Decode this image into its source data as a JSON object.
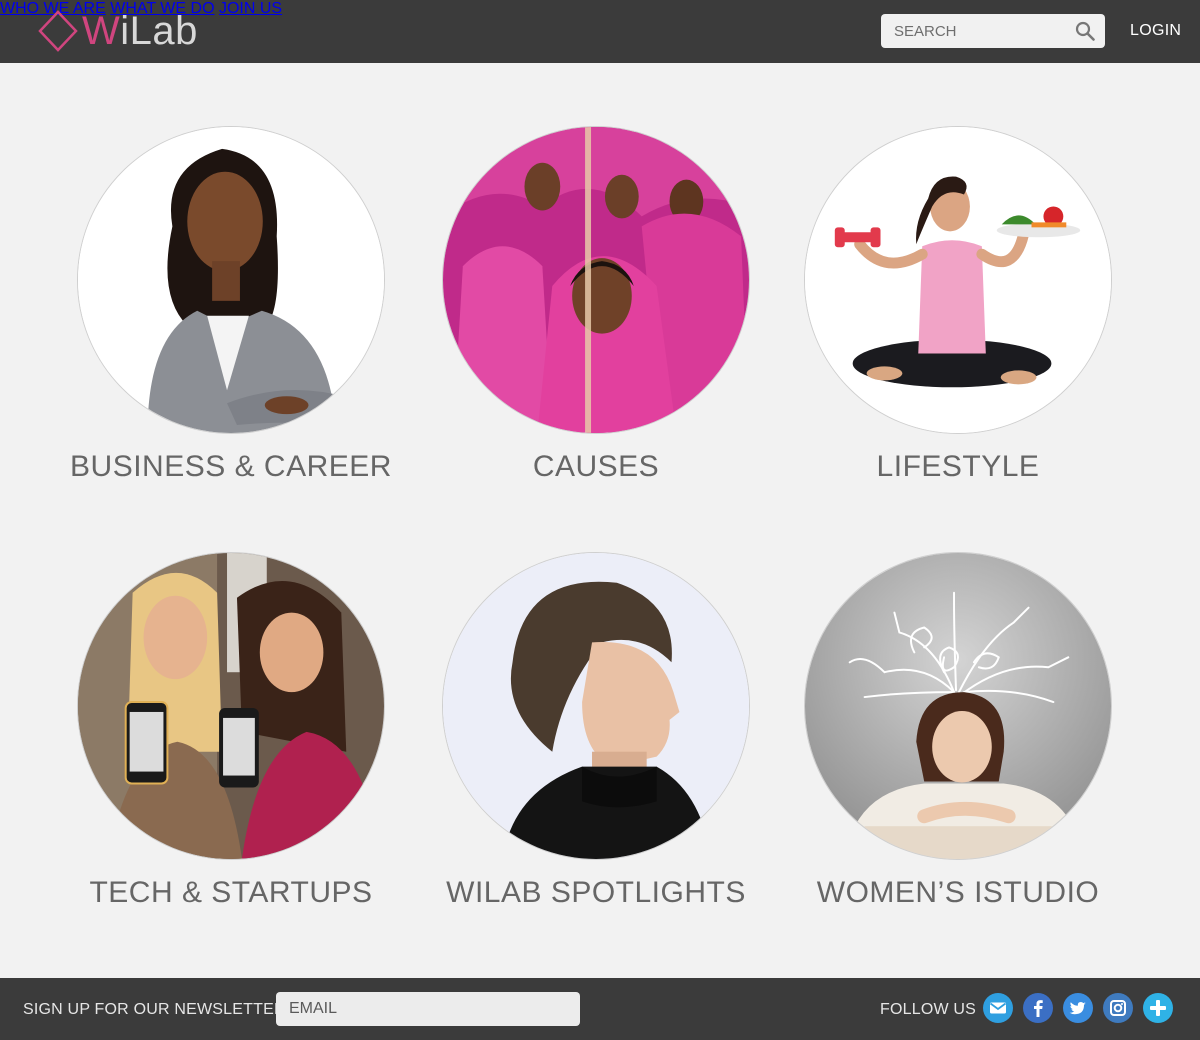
{
  "header": {
    "logo": {
      "w": "W",
      "rest": "iLab",
      "accent": "#d0457f"
    },
    "nav": [
      {
        "label": "WHO WE ARE"
      },
      {
        "label": "WHAT WE DO"
      },
      {
        "label": "JOIN US"
      }
    ],
    "search": {
      "placeholder": "SEARCH",
      "icon": "search-icon"
    },
    "login": "LOGIN"
  },
  "tiles": [
    {
      "label": "BUSINESS & CAREER",
      "image": "businesswoman-portrait"
    },
    {
      "label": "CAUSES",
      "image": "women-in-pink-saris"
    },
    {
      "label": "LIFESTYLE",
      "image": "yoga-woman-with-dumbbell-and-vegetables"
    },
    {
      "label": "TECH & STARTUPS",
      "image": "two-women-holding-phones"
    },
    {
      "label": "WILAB SPOTLIGHTS",
      "image": "woman-profile-black-turtleneck"
    },
    {
      "label": "WOMEN’S ISTUDIO",
      "image": "thinking-woman-with-arrows"
    }
  ],
  "footer": {
    "newsletter_label": "SIGN UP FOR OUR NEWSLETTER",
    "email_placeholder": "EMAIL",
    "follow_label": "FOLLOW US",
    "social": [
      "mail-icon",
      "facebook-icon",
      "twitter-icon",
      "instagram-icon",
      "plus-icon"
    ]
  },
  "colors": {
    "header_bg": "#3b3b3b",
    "page_bg": "#f2f2f2",
    "brand_pink": "#d0457f",
    "social_blue": "#2f9fe0"
  }
}
